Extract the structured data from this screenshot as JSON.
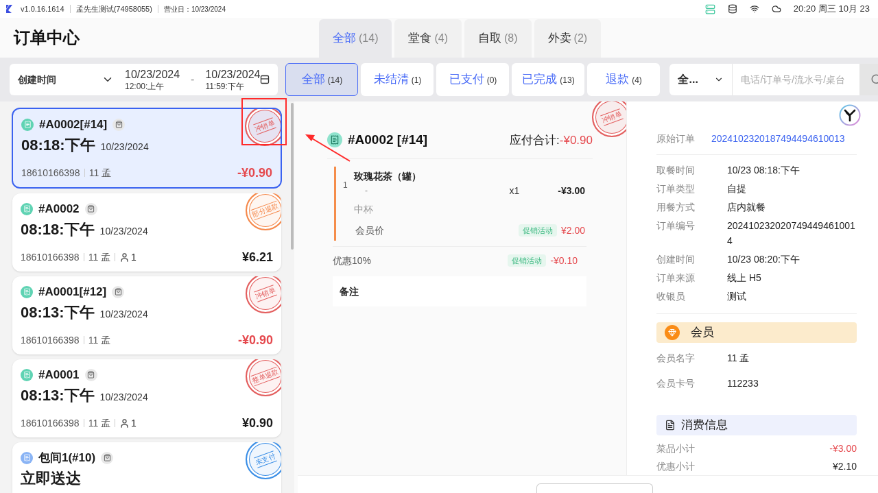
{
  "top_bar": {
    "version": "v1.0.16.1614",
    "store": "孟先生测试(74958055)",
    "business_day_label": "营业日：",
    "business_day": "10/23/2024",
    "clock": "20:20 周三 10月 23"
  },
  "title": "订单中心",
  "type_tabs": [
    {
      "label": "全部",
      "count": "(14)",
      "selected": true
    },
    {
      "label": "堂食",
      "count": "(4)",
      "selected": false
    },
    {
      "label": "自取",
      "count": "(8)",
      "selected": false
    },
    {
      "label": "外卖",
      "count": "(2)",
      "selected": false
    }
  ],
  "filter": {
    "field": "创建时间",
    "start_date": "10/23/2024",
    "start_time": "12:00:上午",
    "separator": "-",
    "end_date": "10/23/2024",
    "end_time": "11:59:下午"
  },
  "status_tabs": [
    {
      "label": "全部",
      "count": "(14)",
      "selected": true
    },
    {
      "label": "未结清",
      "count": "(1)",
      "selected": false
    },
    {
      "label": "已支付",
      "count": "(0)",
      "selected": false
    },
    {
      "label": "已完成",
      "count": "(13)",
      "selected": false
    },
    {
      "label": "退款",
      "count": "(4)",
      "selected": false
    }
  ],
  "search": {
    "scope": "全...",
    "placeholder": "电话/订单号/流水号/桌台"
  },
  "orders": [
    {
      "title": "#A0002[#14]",
      "color": "#5fd3b3",
      "time": "08:18:下午",
      "date": "10/23/2024",
      "phone": "18610166398",
      "name": "11 孟",
      "amount": "-¥0.90",
      "negative": true,
      "selected": true,
      "stamp": {
        "text": "冲销单",
        "color": "#e35d5d"
      }
    },
    {
      "title": "#A0002",
      "color": "#5fd3b3",
      "time": "08:18:下午",
      "date": "10/23/2024",
      "phone": "18610166398",
      "name": "11 孟",
      "guests": "1",
      "amount": "¥6.21",
      "negative": false,
      "selected": false,
      "stamp": {
        "text": "部分退款",
        "color": "#f5884a"
      }
    },
    {
      "title": "#A0001[#12]",
      "color": "#5fd3b3",
      "time": "08:13:下午",
      "date": "10/23/2024",
      "phone": "18610166398",
      "name": "11 孟",
      "amount": "-¥0.90",
      "negative": true,
      "selected": false,
      "stamp": {
        "text": "冲销单",
        "color": "#e35d5d"
      }
    },
    {
      "title": "#A0001",
      "color": "#5fd3b3",
      "time": "08:13:下午",
      "date": "10/23/2024",
      "phone": "18610166398",
      "name": "11 孟",
      "guests": "1",
      "amount": "¥0.90",
      "negative": false,
      "selected": false,
      "stamp": {
        "text": "整单退款",
        "color": "#e35d5d"
      }
    },
    {
      "title": "包间1(#10)",
      "color": "#8ab4f5",
      "time": "立即送达",
      "selected": false,
      "stamp": {
        "text": "未支付",
        "color": "#3a8ee6"
      }
    }
  ],
  "detail": {
    "title": "#A0002 [#14]",
    "total_label": "应付合计:",
    "total": "-¥0.90",
    "stamp": {
      "text": "冲销单",
      "color": "#e35d5d"
    },
    "items": [
      {
        "index": "1",
        "name": "玫瑰花茶（罐）",
        "dash": "-",
        "qty": "x1",
        "price": "-¥3.00",
        "option": "中杯",
        "price_label": "会员价",
        "tag": "促销活动",
        "member_price": "¥2.00"
      }
    ],
    "discounts": [
      {
        "label": "优惠10%",
        "tag": "促销活动",
        "amount": "-¥0.10"
      }
    ],
    "remark_label": "备注"
  },
  "info": {
    "original": {
      "label": "原始订单",
      "value": "2024102320187494494610013"
    },
    "rows": [
      {
        "label": "取餐时间",
        "value": "10/23 08:18:下午"
      },
      {
        "label": "订单类型",
        "value": "自提"
      },
      {
        "label": "用餐方式",
        "value": "店内就餐"
      },
      {
        "label": "订单编号",
        "value": "2024102320207494494610014"
      },
      {
        "label": "创建时间",
        "value": "10/23 08:20:下午"
      },
      {
        "label": "订单来源",
        "value": "线上 H5"
      },
      {
        "label": "收银员",
        "value": "测试"
      }
    ],
    "member_title": "会员",
    "member_rows": [
      {
        "label": "会员名字",
        "value": "11 孟"
      },
      {
        "label": "会员卡号",
        "value": "112233"
      }
    ],
    "spend_title": "消费信息",
    "spend_rows": [
      {
        "label": "菜品小计",
        "value": "-¥3.00",
        "negative": true
      },
      {
        "label": "优惠小计",
        "value": "¥2.10",
        "negative": false
      }
    ]
  }
}
